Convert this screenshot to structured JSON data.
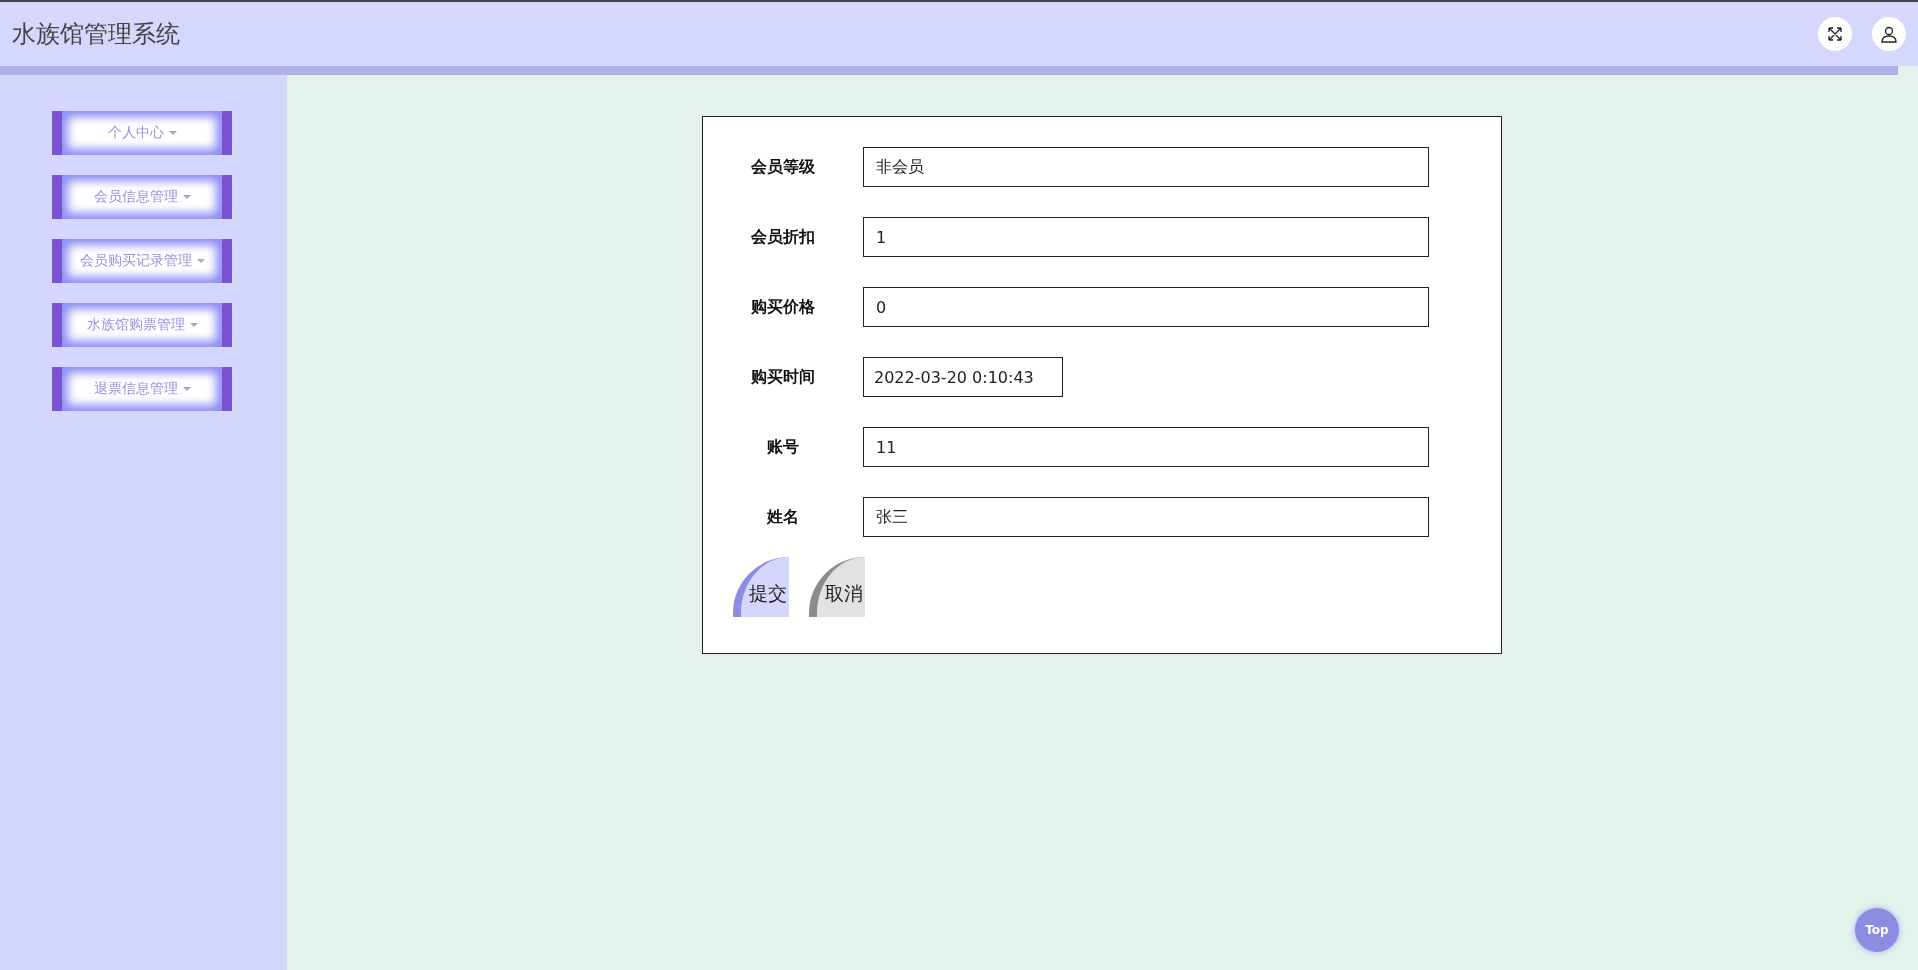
{
  "header": {
    "title": "水族馆管理系统"
  },
  "sidebar": {
    "items": [
      {
        "label": "个人中心"
      },
      {
        "label": "会员信息管理"
      },
      {
        "label": "会员购买记录管理"
      },
      {
        "label": "水族馆购票管理"
      },
      {
        "label": "退票信息管理"
      }
    ]
  },
  "form": {
    "fields": [
      {
        "label": "会员等级",
        "value": "非会员",
        "kind": "wide"
      },
      {
        "label": "会员折扣",
        "value": "1",
        "kind": "wide"
      },
      {
        "label": "购买价格",
        "value": "0",
        "kind": "wide"
      },
      {
        "label": "购买时间",
        "value": "2022-03-20 0:10:43",
        "kind": "short"
      },
      {
        "label": "账号",
        "value": "11",
        "kind": "wide"
      },
      {
        "label": "姓名",
        "value": "张三",
        "kind": "wide"
      }
    ],
    "buttons": [
      {
        "label": "提交",
        "kind": "primary"
      },
      {
        "label": "取消",
        "kind": "secondary"
      }
    ]
  },
  "back_to_top": {
    "label": "Top"
  }
}
